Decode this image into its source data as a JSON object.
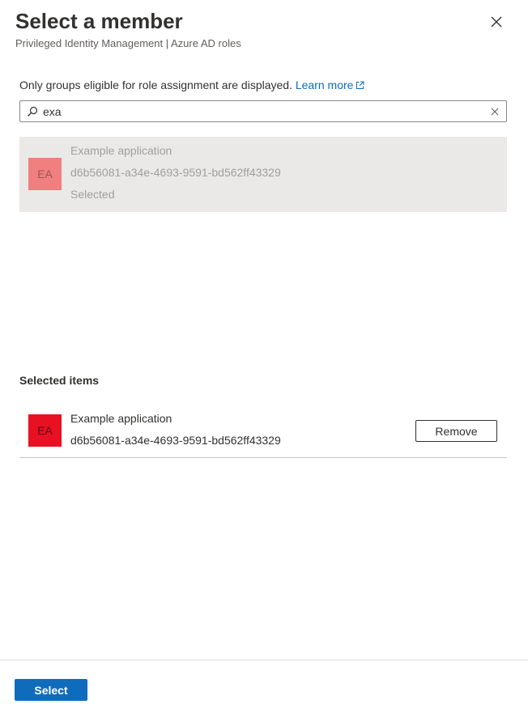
{
  "header": {
    "title": "Select a member",
    "subtitle": "Privileged Identity Management | Azure AD roles"
  },
  "info": {
    "text": "Only groups eligible for role assignment are displayed.",
    "link_label": "Learn more"
  },
  "search": {
    "value": "exa"
  },
  "results": [
    {
      "initials": "EA",
      "name": "Example application",
      "id": "d6b56081-a34e-4693-9591-bd562ff43329",
      "status": "Selected"
    }
  ],
  "selected_section": {
    "title": "Selected items",
    "items": [
      {
        "initials": "EA",
        "name": "Example application",
        "id": "d6b56081-a34e-4693-9591-bd562ff43329",
        "remove_label": "Remove"
      }
    ]
  },
  "footer": {
    "select_label": "Select"
  },
  "icons": {
    "close": "close-icon",
    "external_link": "external-link-icon",
    "search": "search-icon",
    "clear": "clear-icon"
  },
  "colors": {
    "accent": "#0f6cbd",
    "result_avatar": "#f08080",
    "selected_avatar": "#e81123"
  }
}
